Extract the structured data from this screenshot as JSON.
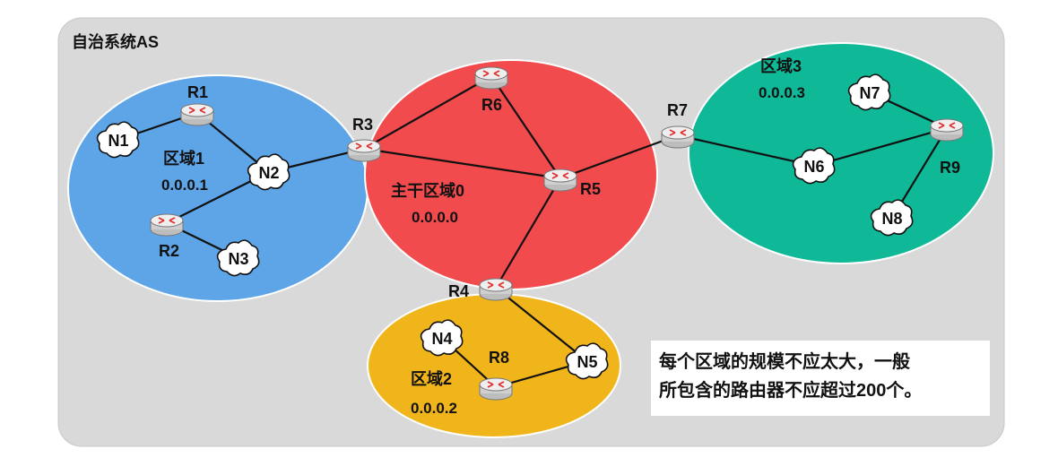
{
  "title": "自治系统AS",
  "colors": {
    "background": "#d9d9d9",
    "area0": "#f24b4d",
    "area1": "#5ea5e8",
    "area2": "#f1b51c",
    "area3": "#0fb896",
    "router_body": "#e9e9e9",
    "router_mark": "#e03030"
  },
  "areas": {
    "area0": {
      "name": "主干区域0",
      "id": "0.0.0.0"
    },
    "area1": {
      "name": "区域1",
      "id": "0.0.0.1"
    },
    "area2": {
      "name": "区域2",
      "id": "0.0.0.2"
    },
    "area3": {
      "name": "区域3",
      "id": "0.0.0.3"
    }
  },
  "routers": {
    "R1": "R1",
    "R2": "R2",
    "R3": "R3",
    "R4": "R4",
    "R5": "R5",
    "R6": "R6",
    "R7": "R7",
    "R8": "R8",
    "R9": "R9"
  },
  "networks": {
    "N1": "N1",
    "N2": "N2",
    "N3": "N3",
    "N4": "N4",
    "N5": "N5",
    "N6": "N6",
    "N7": "N7",
    "N8": "N8"
  },
  "note": {
    "line1": "每个区域的规模不应太大，一般",
    "line2": "所包含的路由器不应超过200个。"
  },
  "icon_names": {
    "router": "router-icon",
    "network": "cloud-icon"
  }
}
